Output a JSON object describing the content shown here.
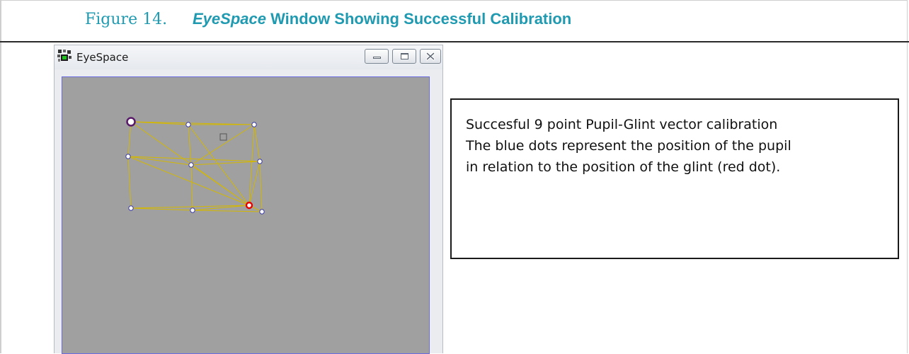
{
  "caption": {
    "number": "Figure 14.",
    "app_name": "EyeSpace",
    "title_rest": " Window Showing Successful Calibration"
  },
  "window": {
    "title": "EyeSpace",
    "buttons": [
      "minimize-icon",
      "maximize-icon",
      "close-icon"
    ]
  },
  "calibration": {
    "grid_points": 9,
    "colors": {
      "canvas": "#a0a0a0",
      "mesh": "#d4b800",
      "calibration_point": "#5a1a6a",
      "pupil_dot": "#ffffff",
      "glint_dot": "#e60000",
      "target_box": "#555555"
    }
  },
  "callout": {
    "lines": [
      "Succesful 9 point Pupil-Glint vector calibration",
      "The blue dots represent the position of the pupil",
      "in relation to the position of the glint (red dot)."
    ]
  }
}
